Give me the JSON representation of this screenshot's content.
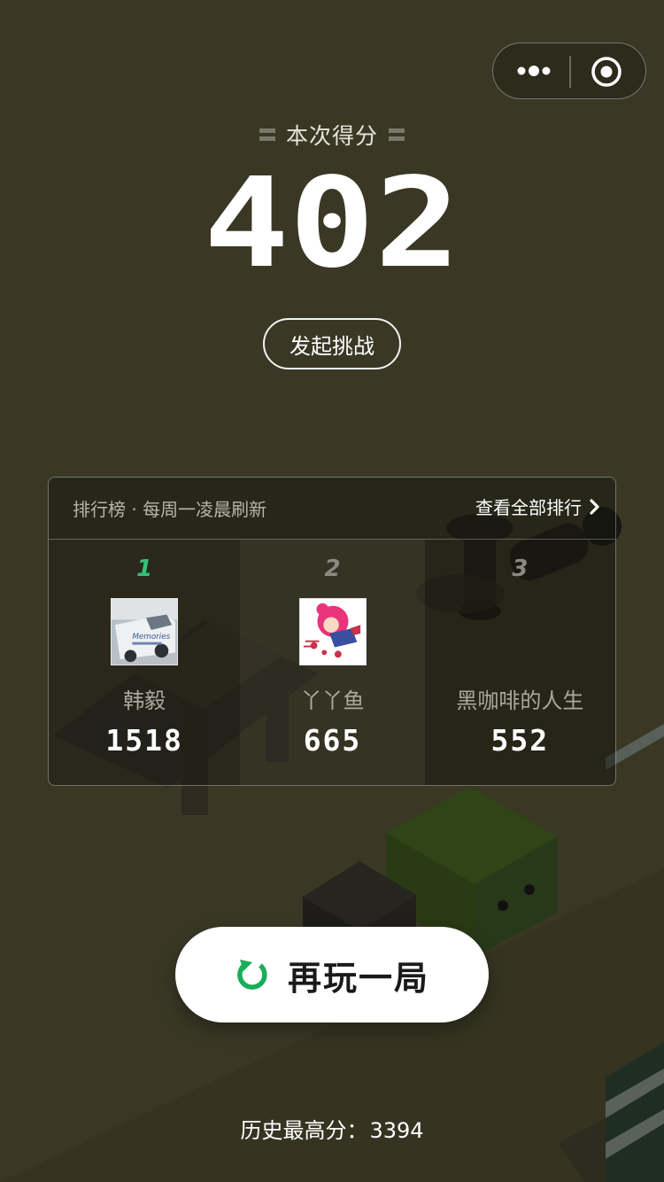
{
  "capsule": {
    "menu_icon": "more-dots-icon",
    "close_icon": "target-circle-icon"
  },
  "score": {
    "label": "本次得分",
    "value": "402"
  },
  "challenge": {
    "label": "发起挑战"
  },
  "leaderboard": {
    "title": "排行榜 · 每周一凌晨刷新",
    "view_all": "查看全部排行",
    "entries": [
      {
        "rank": "1",
        "name": "韩毅",
        "score": "1518",
        "avatar_text": "Memories"
      },
      {
        "rank": "2",
        "name": "丫丫鱼",
        "score": "665"
      },
      {
        "rank": "3",
        "name": "黑咖啡的人生",
        "score": "552"
      }
    ]
  },
  "replay": {
    "label": "再玩一局",
    "icon": "replay-icon"
  },
  "history": {
    "label": "历史最高分：",
    "value": "3394"
  },
  "colors": {
    "background": "#3a3825",
    "accent": "#35c27a",
    "replay_bg": "#ffffff"
  }
}
